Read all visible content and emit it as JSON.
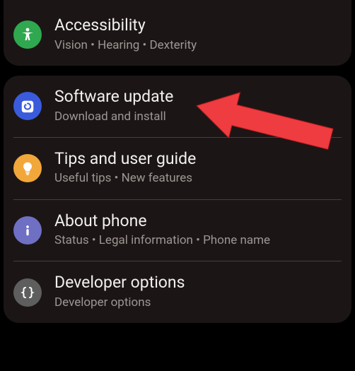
{
  "section_top": {
    "item0": {
      "title": "Accessibility",
      "subtitle": "Vision  •  Hearing  •  Dexterity"
    }
  },
  "section_main": {
    "item0": {
      "title": "Software update",
      "subtitle": "Download and install"
    },
    "item1": {
      "title": "Tips and user guide",
      "subtitle": "Useful tips  •  New features"
    },
    "item2": {
      "title": "About phone",
      "subtitle": "Status  •  Legal information  •  Phone name"
    },
    "item3": {
      "title": "Developer options",
      "subtitle": "Developer options"
    }
  },
  "colors": {
    "accessibility": "#2fa84f",
    "software_update": "#3a5bdc",
    "tips": "#f2a73b",
    "about": "#6f6fc4",
    "developer": "#5e5e5e",
    "arrow": "#ee3c40"
  }
}
